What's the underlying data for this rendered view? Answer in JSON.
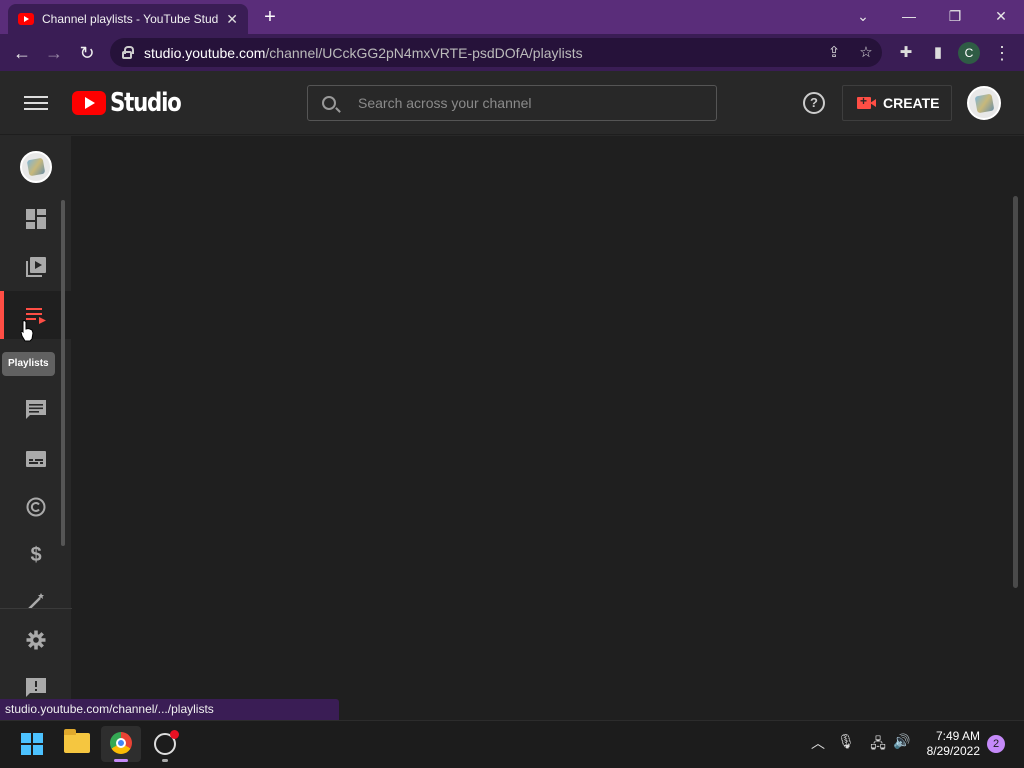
{
  "browser": {
    "tab_title": "Channel playlists - YouTube Studio",
    "new_tab": "+",
    "window_controls": {
      "dropdown": "⌄",
      "minimize": "—",
      "restore": "❐",
      "close": "✕"
    },
    "url_host": "studio.youtube.com",
    "url_path": "/channel/UCckGG2pN4mxVRTE-psdDOfA/playlists",
    "profile_letter": "C",
    "status_url": "studio.youtube.com/channel/.../playlists"
  },
  "studio": {
    "logo_text": "Studio",
    "search_placeholder": "Search across your channel",
    "help_glyph": "?",
    "create_label": "CREATE"
  },
  "nav": {
    "items": [
      {
        "name": "dashboard"
      },
      {
        "name": "content"
      },
      {
        "name": "playlists",
        "active": true
      },
      {
        "name": "comments"
      },
      {
        "name": "subtitles"
      },
      {
        "name": "copyright"
      },
      {
        "name": "earn"
      },
      {
        "name": "customization"
      },
      {
        "name": "settings"
      },
      {
        "name": "send-feedback"
      }
    ],
    "tooltip": "Playlists",
    "accent_color": "#ff4e45"
  },
  "taskbar": {
    "time": "7:49 AM",
    "date": "8/29/2022",
    "notification_count": "2"
  }
}
